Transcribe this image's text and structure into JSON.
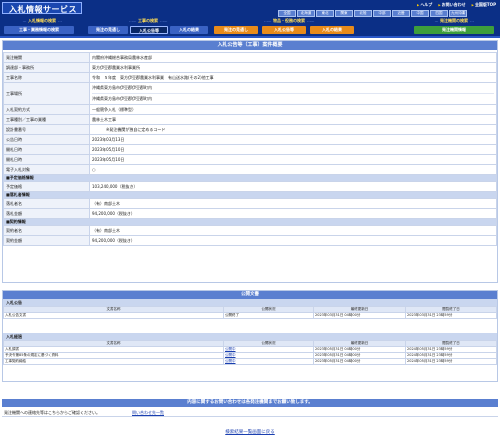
{
  "header": {
    "logo": "入札情報サービス",
    "links": [
      "ヘルプ",
      "お問い合わせ",
      "全国版TOP"
    ],
    "regions": [
      "全国",
      "北海道",
      "東北",
      "関東",
      "北陸",
      "中部",
      "近畿",
      "中国",
      "四国",
      "九州沖縄"
    ],
    "categories": {
      "bid_info": "入札情報の検索",
      "construction": "工事の検索",
      "goods": "物品・役務の検索",
      "orderer": "発注機関の検索"
    },
    "tabs": [
      "工事・業務情報の検索",
      "発注の見通し",
      "入札公告等",
      "入札の結果",
      "発注の見通し",
      "入札公告等",
      "入札の結果",
      "発注機関情報"
    ]
  },
  "detail": {
    "title": "入札公告等（工事）案件概要",
    "rows": [
      {
        "label": "発注機関",
        "value": "内閣府沖縄総合事務局農林水産部"
      },
      {
        "label": "調達部・事務所",
        "value": "東方伊豆郡農業水利事業所"
      },
      {
        "label": "工事名称",
        "value": "令和　５年度　東方伊豆郡農業水利事業　有山送水路(その2)他工事"
      },
      {
        "label": "工事場所",
        "value": "沖縄県東方島市伊豆郡伊豆郡町内",
        "value2": "沖縄県東方島市伊豆郡伊豆郡町内"
      },
      {
        "label": "入札契約方式",
        "value": "一般競争入札（標準型）"
      },
      {
        "label": "工事種別／工事の業種",
        "value": "農林土木工事"
      },
      {
        "label": "設計書番号",
        "value": "※発注機関が独自に定めるコード"
      },
      {
        "label": "公告日時",
        "value": "2023年03月13日"
      },
      {
        "label": "開札日時",
        "value": "2023年05月10日"
      },
      {
        "label": "開札日時",
        "value": "2023年05月10日"
      },
      {
        "label": "電子入札対象",
        "value": "○"
      }
    ],
    "sections": {
      "estimate": {
        "title": "■予定価格情報",
        "label": "予定価格",
        "value": "103,240,000（税抜き）"
      },
      "winner": {
        "title": "■落札者情報",
        "name_label": "落札者名",
        "name_value": "（有）南部土木",
        "price_label": "落札金額",
        "price_value": "94,200,000（税抜き）"
      },
      "contract": {
        "title": "■契約情報",
        "name_label": "契約者名",
        "name_value": "（有）南部土木",
        "price_label": "契約金額",
        "price_value": "94,200,000（税抜き）"
      }
    }
  },
  "docs": {
    "title": "公開文書",
    "announcement": {
      "section": "入札公告",
      "headers": [
        "文書名称",
        "公開状況",
        "最終更新日",
        "閲覧終了日"
      ],
      "rows": [
        {
          "name": "入札公告文書",
          "status": "公開終了",
          "updated": "2023年03月31日 04時00分",
          "end": "2023年03月31日 23時59分"
        }
      ]
    },
    "result": {
      "section": "入札経過",
      "headers": [
        "文書名称",
        "公開状況",
        "最終更新日",
        "閲覧終了日"
      ],
      "rows": [
        {
          "name": "入札調書",
          "status": "公開中",
          "updated": "2023年05月31日 04時00分",
          "end": "2024年05月31日 23時59分"
        },
        {
          "name": "予決令第85条の規定に基づく資料",
          "status": "公開中",
          "updated": "2023年05月31日 04時00分",
          "end": "2024年05月31日 23時59分"
        },
        {
          "name": "工事契約締結",
          "status": "公開中",
          "updated": "2023年05月31日 04時00分",
          "end": "2024年05月31日 23時59分"
        }
      ]
    }
  },
  "footer": {
    "notice": "内容に関するお問い合わせは各発注機関までお願い致します。",
    "contact_text": "発注機関への連絡先等はこちらからご確認ください。",
    "contact_link": "問い合わせ先一覧",
    "back_link": "検索結果一覧画面に戻る"
  },
  "colors": {
    "header_bg": "#0b2f86",
    "panel_title": "#5a7fd0",
    "section_bg": "#c9d6ef",
    "tab_orange": "#e88b1a",
    "tab_green": "#3d9e3b"
  }
}
